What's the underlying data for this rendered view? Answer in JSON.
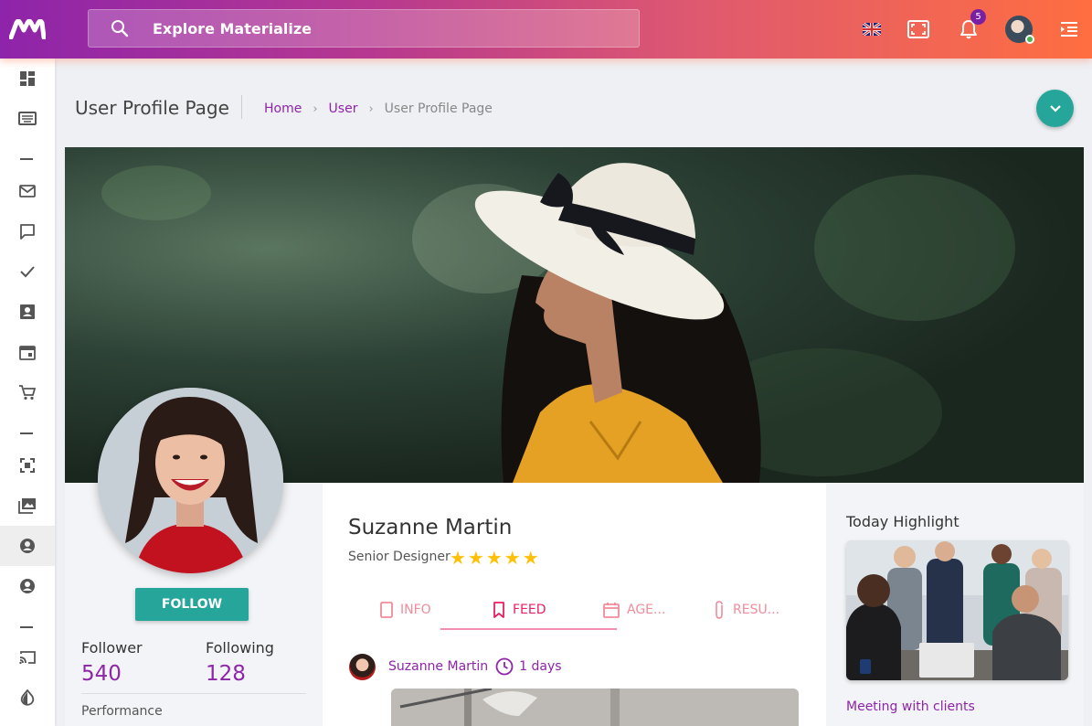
{
  "header": {
    "search_placeholder": "Explore Materialize",
    "notification_count": "5"
  },
  "page": {
    "title": "User Profile Page",
    "breadcrumbs": [
      "Home",
      "User",
      "User Profile Page"
    ]
  },
  "profile": {
    "name": "Suzanne Martin",
    "role": "Senior Designer",
    "stars": "★★★★★",
    "rating": 5,
    "follow_label": "FOLLOW",
    "follower_label": "Follower",
    "follower_count": "540",
    "following_label": "Following",
    "following_count": "128",
    "performance_label": "Performance"
  },
  "tabs": [
    {
      "label": "INFO",
      "icon": "tablet-icon"
    },
    {
      "label": "FEED",
      "icon": "bookmark-icon",
      "active": true
    },
    {
      "label": "AGE...",
      "icon": "calendar-icon"
    },
    {
      "label": "RESU...",
      "icon": "paperclip-icon"
    }
  ],
  "post": {
    "author": "Suzanne Martin",
    "time": "1 days"
  },
  "highlight": {
    "title": "Today Highlight",
    "caption": "Meeting with clients"
  },
  "colors": {
    "accent": "#8e24aa",
    "teal": "#26a69a",
    "tab_active": "#e91e63",
    "star": "#ffc107"
  }
}
